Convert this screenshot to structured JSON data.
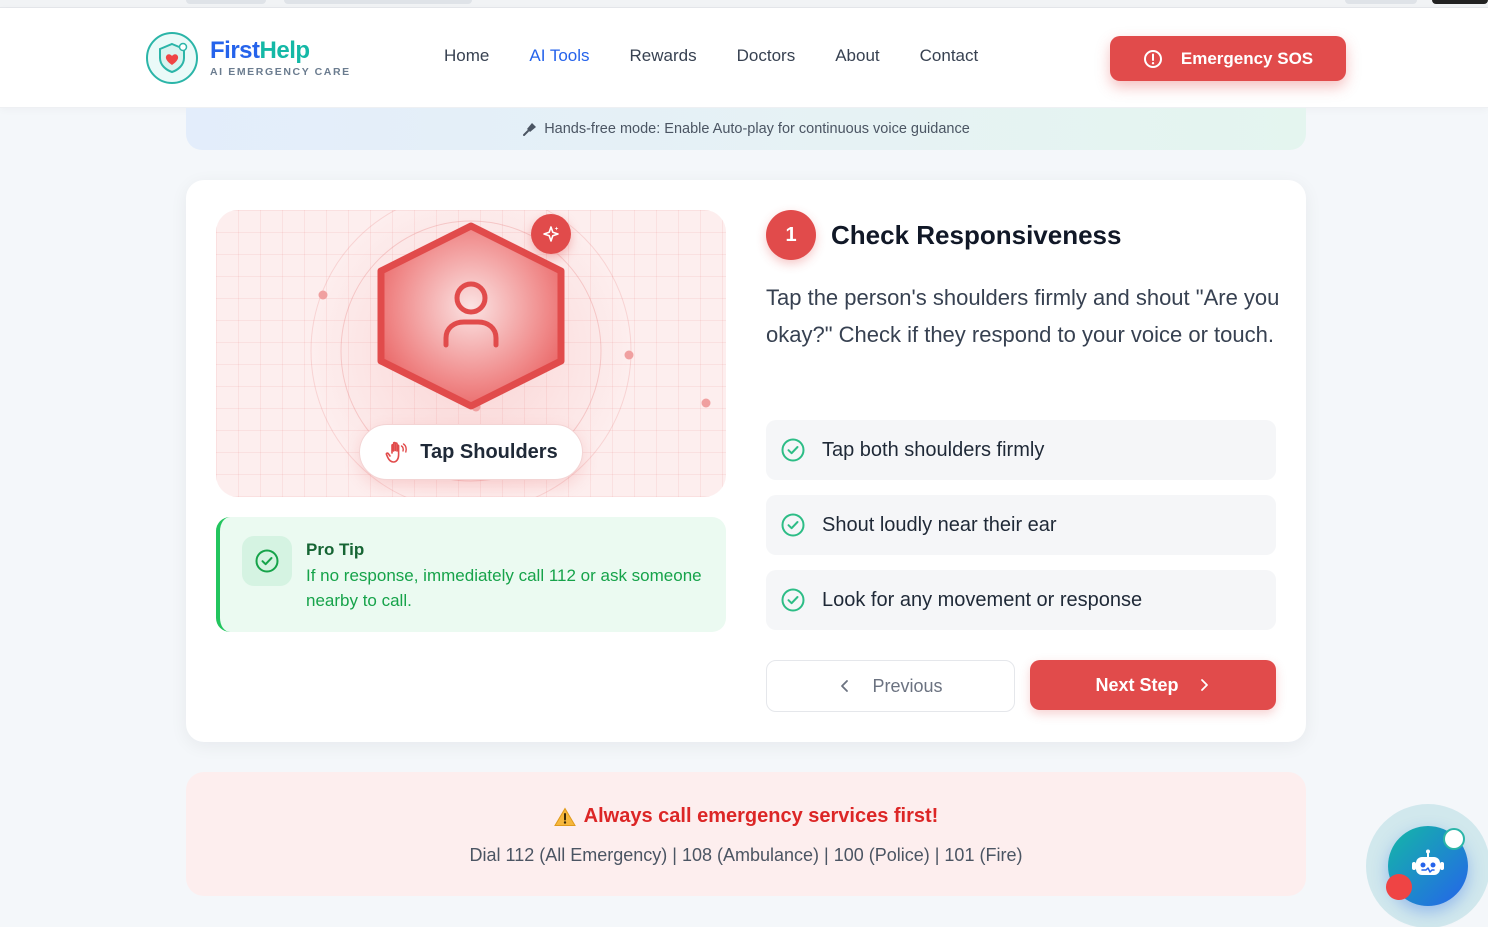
{
  "brand": {
    "title_first": "First",
    "title_second": "Help",
    "subtitle": "AI EMERGENCY CARE"
  },
  "nav": {
    "items": [
      {
        "label": "Home",
        "active": false
      },
      {
        "label": "AI Tools",
        "active": true
      },
      {
        "label": "Rewards",
        "active": false
      },
      {
        "label": "Doctors",
        "active": false
      },
      {
        "label": "About",
        "active": false
      },
      {
        "label": "Contact",
        "active": false
      }
    ]
  },
  "sos": {
    "label": "Emergency SOS",
    "icon": "alert-circle-icon"
  },
  "banner": {
    "icon": "microphone-icon",
    "text": "Hands-free mode: Enable Auto-play for continuous voice guidance"
  },
  "illustration": {
    "action_label": "Tap Shoulders",
    "action_icon": "hand-icon",
    "badge_icon": "sparkle-icon",
    "center_icon": "person-icon"
  },
  "pro_tip": {
    "title": "Pro Tip",
    "text": "If no response, immediately call 112 or ask someone nearby to call."
  },
  "step": {
    "number": "1",
    "title": "Check Responsiveness",
    "description": "Tap the person's shoulders firmly and shout \"Are you okay?\" Check if they respond to your voice or touch.",
    "checklist": [
      "Tap both shoulders firmly",
      "Shout loudly near their ear",
      "Look for any movement or response"
    ]
  },
  "controls": {
    "previous_label": "Previous",
    "next_label": "Next Step"
  },
  "notice": {
    "title": "Always call emergency services first!",
    "text": "Dial 112 (All Emergency) | 108 (Ambulance) | 100 (Police) | 101 (Fire)"
  },
  "colors": {
    "accent_red": "#e14b4b",
    "brand_blue": "#2563eb",
    "brand_teal": "#14b8a6",
    "success_green": "#22c55e"
  }
}
